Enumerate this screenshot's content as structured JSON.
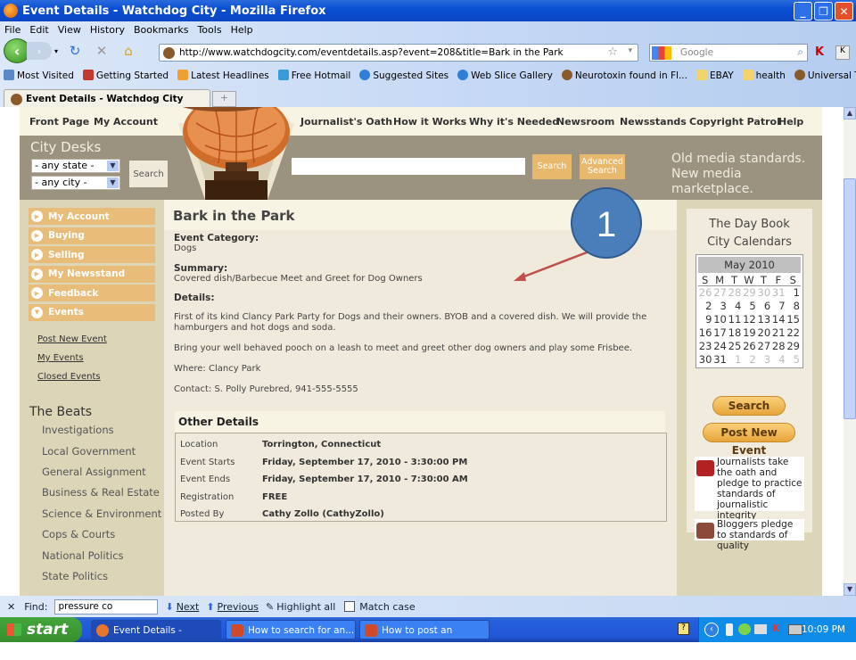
{
  "window": {
    "title": "Event Details - Watchdog City - Mozilla Firefox",
    "controls": [
      "minimize",
      "restore",
      "close"
    ]
  },
  "menubar": [
    "File",
    "Edit",
    "View",
    "History",
    "Bookmarks",
    "Tools",
    "Help"
  ],
  "address": {
    "url": "http://www.watchdogcity.com/eventdetails.asp?event=208&title=Bark in the Park",
    "search_placeholder": "Google"
  },
  "bookmarks": [
    {
      "label": "Most Visited",
      "color": "#5b88c8"
    },
    {
      "label": "Getting Started",
      "color": "#c0392b"
    },
    {
      "label": "Latest Headlines",
      "color": "#f0a030"
    },
    {
      "label": "Free Hotmail",
      "color": "#3a9ad9"
    },
    {
      "label": "Suggested Sites",
      "color": "#2f7fd6"
    },
    {
      "label": "Web Slice Gallery",
      "color": "#2f7fd6"
    },
    {
      "label": "Neurotoxin found in Fl...",
      "color": "#8b5a2b"
    },
    {
      "label": "EBAY",
      "color": "#f3d36b"
    },
    {
      "label": "health",
      "color": "#f3d36b"
    },
    {
      "label": "Universal Terms of Se...",
      "color": "#8b5a2b"
    }
  ],
  "bookmarks_overflow": "»",
  "tab": {
    "label": "Event Details - Watchdog City",
    "new_tab": "+"
  },
  "site": {
    "topnav": [
      "Front Page",
      "My Account",
      "Journalist's Oath",
      "How it Works",
      "Why it's Needed",
      "Newsroom",
      "Newsstands",
      "Copyright Patrol",
      "Help"
    ],
    "city_desks": "City Desks",
    "state_select": "- any state -",
    "city_select": "- any city -",
    "city_search_btn": "Search",
    "search_btn": "Search",
    "advanced_search_btn_line1": "Advanced",
    "advanced_search_btn_line2": "Search",
    "tagline_line1": "Old media standards.",
    "tagline_line2": "New media marketplace.",
    "accordion": [
      {
        "label": "My Account",
        "expanded": false
      },
      {
        "label": "Buying",
        "expanded": false
      },
      {
        "label": "Selling",
        "expanded": false
      },
      {
        "label": "My Newsstand",
        "expanded": false
      },
      {
        "label": "Feedback",
        "expanded": false
      },
      {
        "label": "Events",
        "expanded": true
      }
    ],
    "event_links": [
      "Post New Event",
      "My Events",
      "Closed Events"
    ],
    "beats_title": "The Beats",
    "beats": [
      "Investigations",
      "Local Government",
      "General Assignment",
      "Business & Real Estate",
      "Science & Environment",
      "Cops & Courts",
      "National Politics",
      "State Politics"
    ]
  },
  "event": {
    "title": "Bark in the Park",
    "category_label": "Event Category:",
    "category": "Dogs",
    "summary_label": "Summary:",
    "summary": "Covered dish/Barbecue Meet and Greet for Dog Owners",
    "details_label": "Details:",
    "details": [
      "First of its kind Clancy Park Party for Dogs and their owners. BYOB and a covered dish. We will provide the hamburgers and hot dogs and soda.",
      "Bring your well behaved pooch on a leash to meet and greet other dog owners and play some Frisbee.",
      "Where: Clancy Park",
      "Contact: S. Polly Purebred, 941-555-5555"
    ],
    "other_details_title": "Other Details",
    "other_details": [
      {
        "key": "Location",
        "value": "Torrington, Connecticut"
      },
      {
        "key": "Event Starts",
        "value": "Friday, September 17, 2010 - 3:30:00 PM"
      },
      {
        "key": "Event Ends",
        "value": "Friday, September 17, 2010 - 7:30:00 AM"
      },
      {
        "key": "Registration",
        "value": "FREE"
      },
      {
        "key": "Posted By",
        "value": "Cathy Zollo (CathyZollo)"
      }
    ]
  },
  "sidebar_right": {
    "title_line1": "The Day Book",
    "title_line2": "City Calendars",
    "calendar": {
      "month": "May 2010",
      "dow": [
        "S",
        "M",
        "T",
        "W",
        "T",
        "F",
        "S"
      ],
      "days": [
        [
          "26",
          "27",
          "28",
          "29",
          "30",
          "31",
          "1"
        ],
        [
          "2",
          "3",
          "4",
          "5",
          "6",
          "7",
          "8"
        ],
        [
          "9",
          "10",
          "11",
          "12",
          "13",
          "14",
          "15"
        ],
        [
          "16",
          "17",
          "18",
          "19",
          "20",
          "21",
          "22"
        ],
        [
          "23",
          "24",
          "25",
          "26",
          "27",
          "28",
          "29"
        ],
        [
          "30",
          "31",
          "1",
          "2",
          "3",
          "4",
          "5"
        ]
      ]
    },
    "search_btn": "Search",
    "post_event_btn": "Post New Event",
    "promo1": "Journalists take the oath and pledge to practice standards of journalistic integrity",
    "promo2": "Bloggers pledge to standards of quality"
  },
  "annotation": {
    "number": "1",
    "color": "#4a7ebb",
    "arrow_color": "#c0504d"
  },
  "findbar": {
    "close": "✕",
    "label": "Find:",
    "value": "pressure co",
    "next": "Next",
    "previous": "Previous",
    "highlight": "Highlight all",
    "match_case": "Match case"
  },
  "taskbar": {
    "start": "start",
    "tasks": [
      "Event Details - Watch...",
      "How to search for an...",
      "How to post an event..."
    ],
    "clock": "10:09 PM"
  }
}
